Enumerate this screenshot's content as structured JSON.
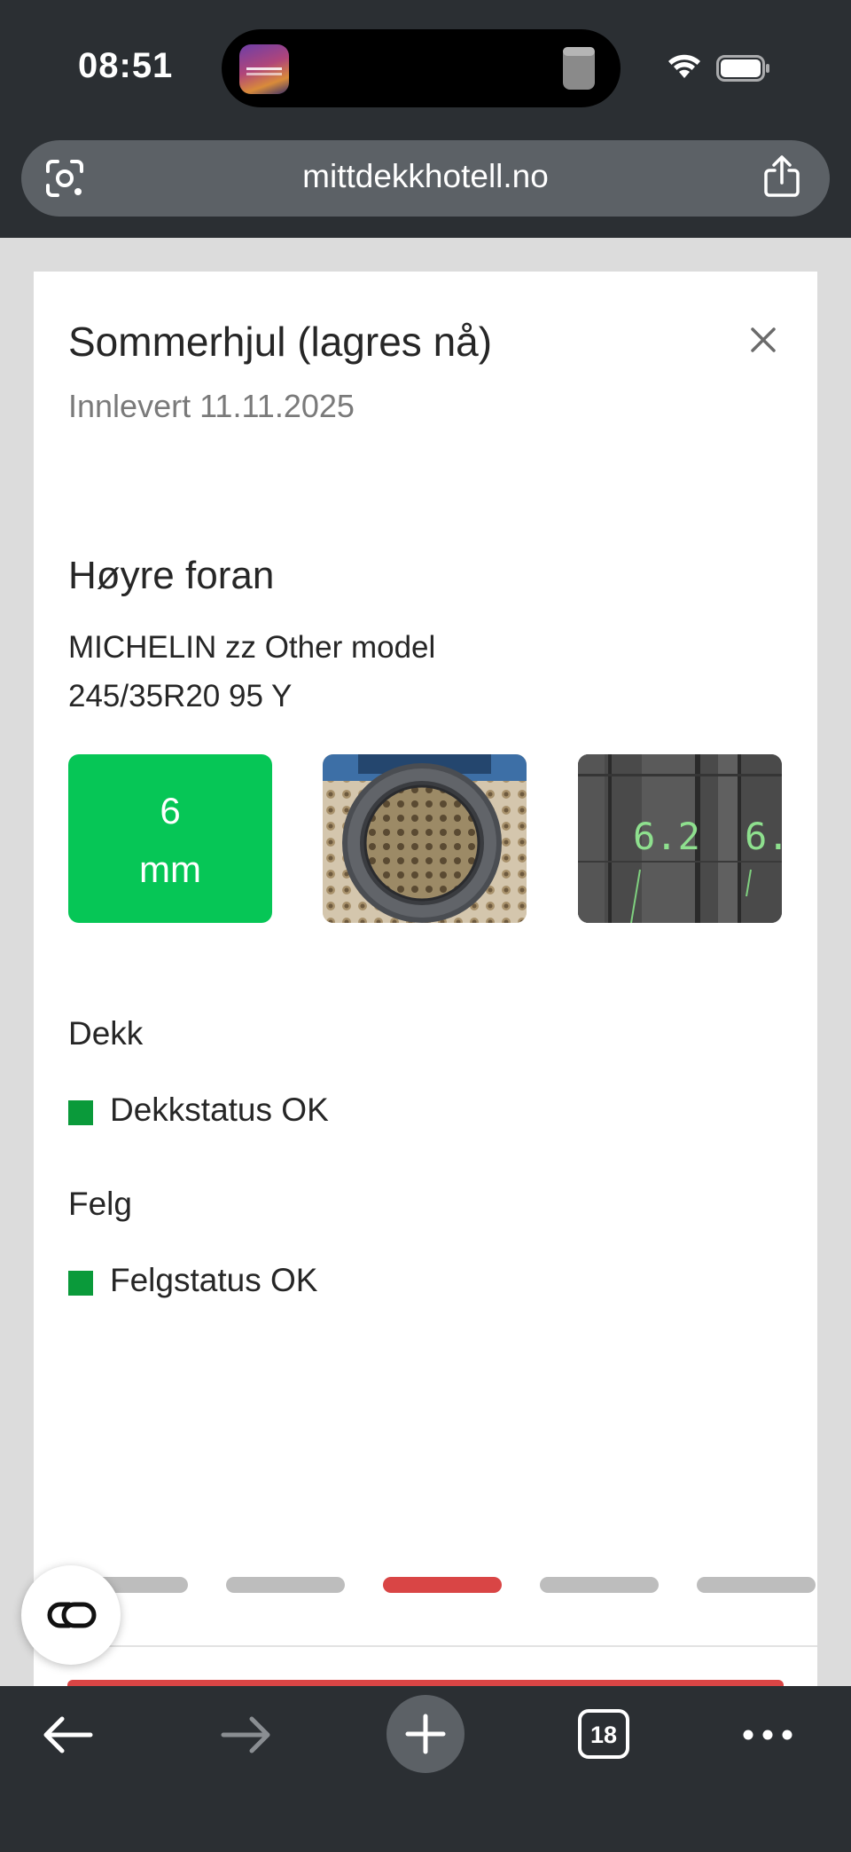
{
  "status_bar": {
    "time": "08:51"
  },
  "browser": {
    "url": "mittdekkhotell.no",
    "tabs_count": "18"
  },
  "card": {
    "title": "Sommerhjul (lagres nå)",
    "subtitle": "Innlevert 11.11.2025",
    "wheel_position": "Høyre foran",
    "tire_model": "MICHELIN zz Other model",
    "tire_size": "245/35R20 95 Y",
    "tread_depth": {
      "value": "6",
      "unit": "mm"
    },
    "scan_readings": [
      "6.2",
      "6."
    ],
    "tire_section": {
      "label": "Dekk",
      "status_text": "Dekkstatus OK",
      "status_color": "#0a9a3a"
    },
    "rim_section": {
      "label": "Felg",
      "status_text": "Felgstatus OK",
      "status_color": "#0a9a3a"
    },
    "pagination": {
      "total": 5,
      "active_index": 2
    }
  },
  "colors": {
    "ok_green": "#06c656",
    "accent_red": "#d94545",
    "chrome_dark": "#2b2f33"
  },
  "icons": [
    "camera-lens-icon",
    "share-icon",
    "close-icon",
    "back-arrow-icon",
    "forward-arrow-icon",
    "plus-icon",
    "tabs-icon",
    "more-icon",
    "wifi-icon",
    "battery-icon",
    "copilot-icon"
  ]
}
